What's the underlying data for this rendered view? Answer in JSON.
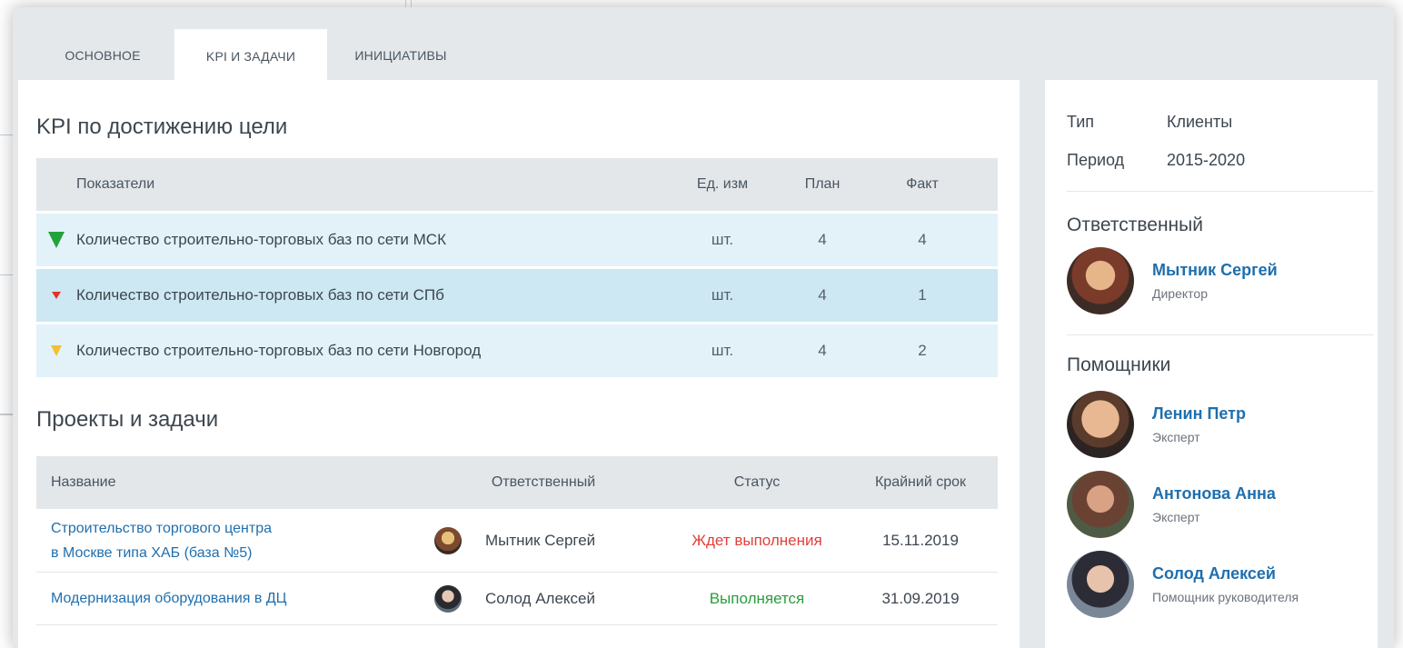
{
  "tabs": [
    {
      "label": "ОСНОВНОЕ"
    },
    {
      "label": "KPI И ЗАДАЧИ"
    },
    {
      "label": "ИНИЦИАТИВЫ"
    }
  ],
  "kpi": {
    "title": "KPI по достижению цели",
    "columns": {
      "name": "Показатели",
      "unit": "Ед. изм",
      "plan": "План",
      "fact": "Факт"
    },
    "rows": [
      {
        "name": "Количество строительно-торговых баз по сети МСК",
        "unit": "шт.",
        "plan": "4",
        "fact": "4",
        "flag": "green-funnel-icon"
      },
      {
        "name": "Количество строительно-торговых баз по сети СПб",
        "unit": "шт.",
        "plan": "4",
        "fact": "1",
        "flag": "red-funnel-icon"
      },
      {
        "name": "Количество строительно-торговых баз по сети Новгород",
        "unit": "шт.",
        "plan": "4",
        "fact": "2",
        "flag": "yellow-funnel-icon"
      }
    ],
    "colors": {
      "green": "#21a33b",
      "red": "#e2332f",
      "yellow": "#f2c12e"
    }
  },
  "projects": {
    "title": "Проекты и задачи",
    "columns": {
      "name": "Название",
      "responsible": "Ответственный",
      "status": "Статус",
      "deadline": "Крайний срок"
    },
    "rows": [
      {
        "name_line1": "Строительство торгового центра",
        "name_line2": "в Москве типа ХАБ (база №5)",
        "responsible": "Мытник Сергей",
        "status": "Ждет выполнения",
        "deadline": "15.11.2019"
      },
      {
        "name_line1": "Модернизация оборудования в ДЦ",
        "name_line2": "",
        "responsible": "Солод Алексей",
        "status": "Выполняется",
        "deadline": "31.09.2019"
      }
    ],
    "status_colors": {
      "waiting": "#e0403a",
      "in_progress": "#2c9c3f"
    }
  },
  "side": {
    "type_label": "Тип",
    "type_value": "Клиенты",
    "period_label": "Период",
    "period_value": "2015-2020",
    "responsible_title": "Ответственный",
    "responsible": {
      "name": "Мытник Сергей",
      "role": "Директор"
    },
    "helpers_title": "Помощники",
    "helpers": [
      {
        "name": "Ленин Петр",
        "role": "Эксперт"
      },
      {
        "name": "Антонова Анна",
        "role": "Эксперт"
      },
      {
        "name": "Солод Алексей",
        "role": "Помощник руководителя"
      }
    ]
  },
  "accent_color": "#1f6fae"
}
